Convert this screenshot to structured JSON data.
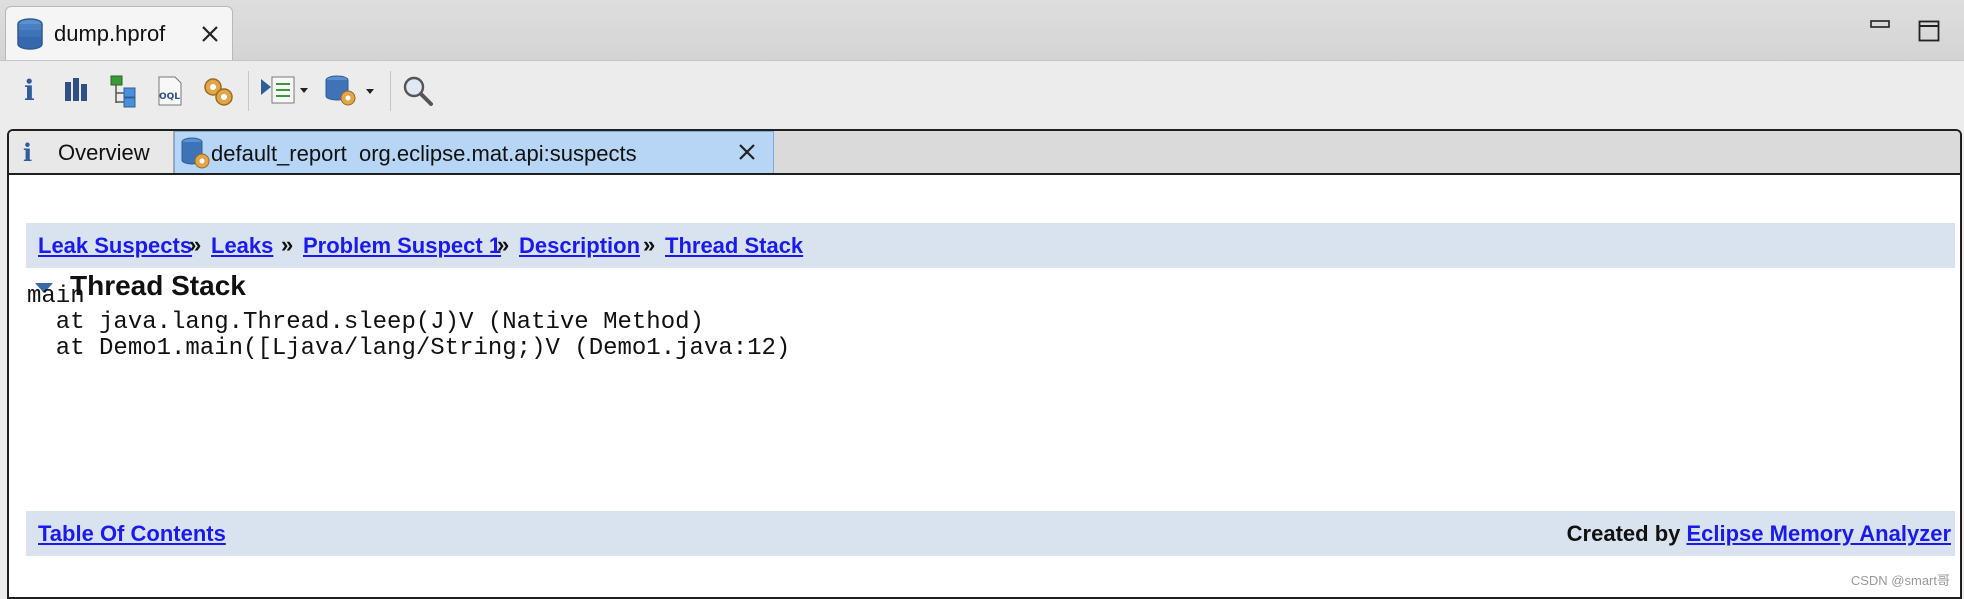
{
  "editor_tab": {
    "title": "dump.hprof",
    "icon": "database-icon",
    "close_icon": "close-icon"
  },
  "window_controls": [
    "minimize-icon",
    "maximize-icon"
  ],
  "toolbar": {
    "buttons": [
      "info-icon",
      "histogram-icon",
      "dominator-tree-icon",
      "oql-icon",
      "thread-overview-icon",
      "query-browser-icon",
      "run-report-icon",
      "search-icon"
    ]
  },
  "subtabs": [
    {
      "label": "Overview",
      "icon": "info-icon"
    },
    {
      "label": "default_report  org.eclipse.mat.api:suspects",
      "icon": "report-icon",
      "active": true
    }
  ],
  "breadcrumb": {
    "separator": "»",
    "items": [
      "Leak Suspects",
      "Leaks",
      "Problem Suspect 1",
      "Description",
      "Thread Stack"
    ]
  },
  "section": {
    "title": "Thread Stack",
    "expanded": true
  },
  "thread_stack": [
    "main",
    "  at java.lang.Thread.sleep(J)V (Native Method)",
    "  at Demo1.main([Ljava/lang/String;)V (Demo1.java:12)"
  ],
  "footer": {
    "toc_link": "Table Of Contents",
    "created_by_prefix": "Created by ",
    "created_by_link": "Eclipse Memory Analyzer"
  },
  "watermark": "CSDN @smart哥",
  "colors": {
    "link": "#1a1aee",
    "bar_background": "#d8e3ef",
    "active_tab": "#b7d5f4"
  }
}
